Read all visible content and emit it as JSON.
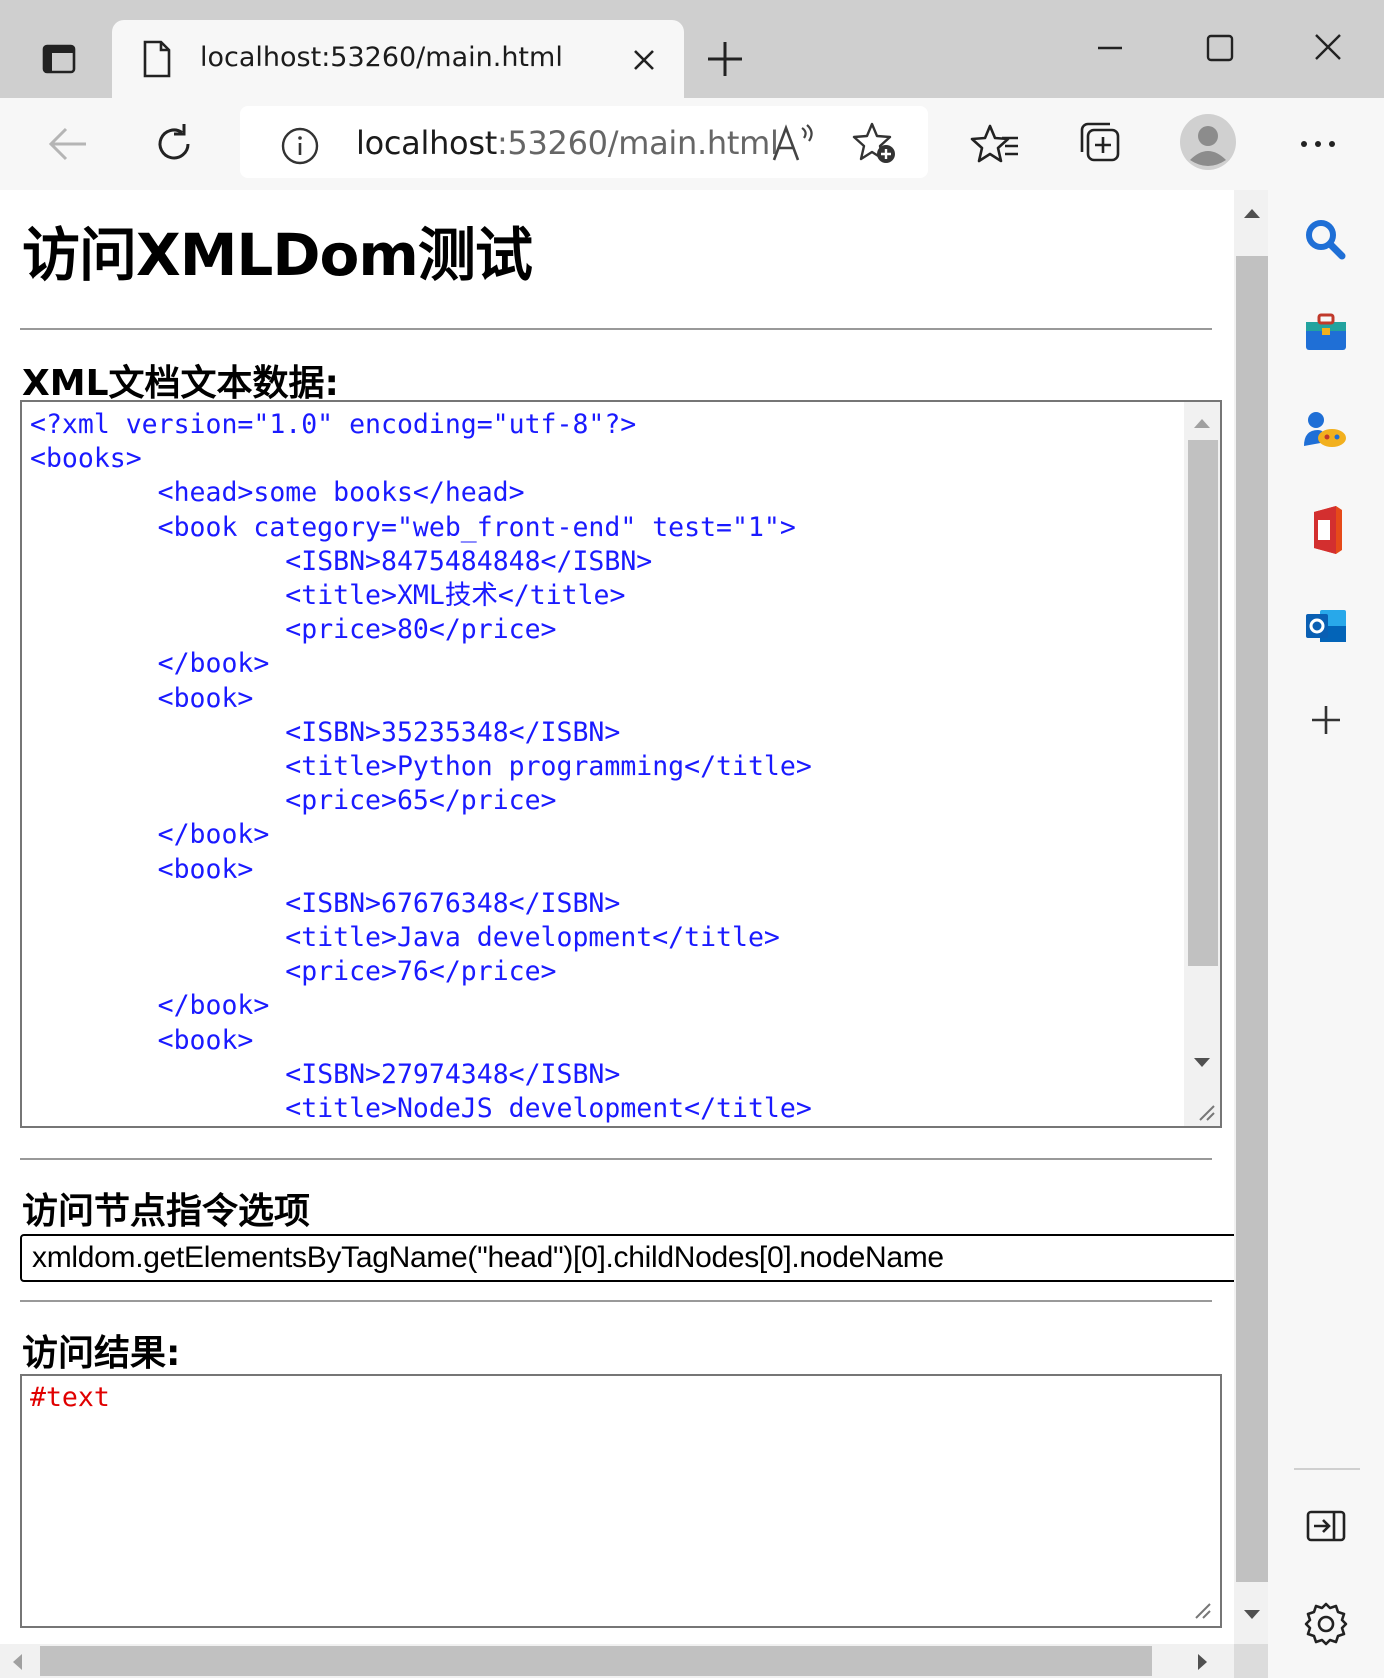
{
  "browser": {
    "tab": {
      "title": "localhost:53260/main.html"
    },
    "address": {
      "host": "localhost",
      "rest": ":53260/main.html"
    },
    "toolbar_icons": [
      "back-icon",
      "refresh-icon",
      "info-icon",
      "read-aloud-icon",
      "add-favorite-icon",
      "favorites-icon",
      "collections-icon",
      "profile-icon",
      "more-icon"
    ],
    "sidebar_icons": [
      "search-icon",
      "tools-icon",
      "games-icon",
      "office-icon",
      "outlook-icon",
      "add-icon",
      "split-screen-icon",
      "settings-icon"
    ]
  },
  "page": {
    "title": "访问XMLDom测试",
    "xml_section_label": "XML文档文本数据:",
    "xml_lines": [
      "<?xml version=\"1.0\" encoding=\"utf-8\"?>",
      "<books>",
      "\t<head>some books</head>",
      "\t<book category=\"web_front-end\" test=\"1\">",
      "\t\t<ISBN>8475484848</ISBN>",
      "\t\t<title>XML技术</title>",
      "\t\t<price>80</price>",
      "\t</book>",
      "\t<book>",
      "\t\t<ISBN>35235348</ISBN>",
      "\t\t<title>Python programming</title>",
      "\t\t<price>65</price>",
      "\t</book>",
      "\t<book>",
      "\t\t<ISBN>67676348</ISBN>",
      "\t\t<title>Java development</title>",
      "\t\t<price>76</price>",
      "\t</book>",
      "\t<book>",
      "\t\t<ISBN>27974348</ISBN>",
      "\t\t<title>NodeJS development</title>"
    ],
    "command_section_label": "访问节点指令选项",
    "command_value": "xmldom.getElementsByTagName(\"head\")[0].childNodes[0].nodeName",
    "result_section_label": "访问结果:",
    "result_value": "#text"
  },
  "colors": {
    "xml_text": "#1a1aff",
    "result_text": "#e00000",
    "chrome_bg": "#cfcfcf",
    "toolbar_bg": "#f7f7f7"
  }
}
